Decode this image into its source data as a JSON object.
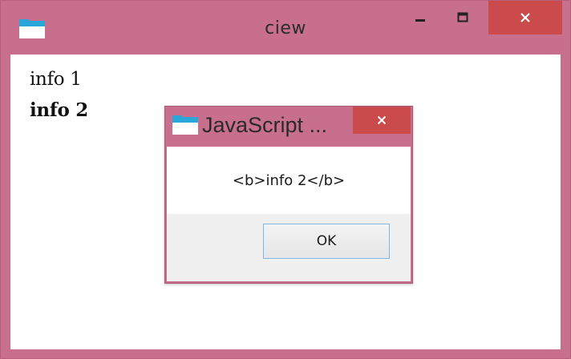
{
  "window": {
    "title": "ciew"
  },
  "content": {
    "lines": [
      "info 1",
      "info 2"
    ]
  },
  "dialog": {
    "title": "JavaScript ...",
    "message": "<b>info 2</b>",
    "ok_label": "OK"
  },
  "colors": {
    "frame": "#c86f8d",
    "close_button": "#cb4a4c",
    "client_background": "#ffffff",
    "dialog_footer": "#f0f0f0",
    "ok_border": "#7fb6e3"
  },
  "icons": {
    "app": "folder-window-icon",
    "minimize": "minimize-icon",
    "maximize": "maximize-icon",
    "close": "close-icon"
  }
}
